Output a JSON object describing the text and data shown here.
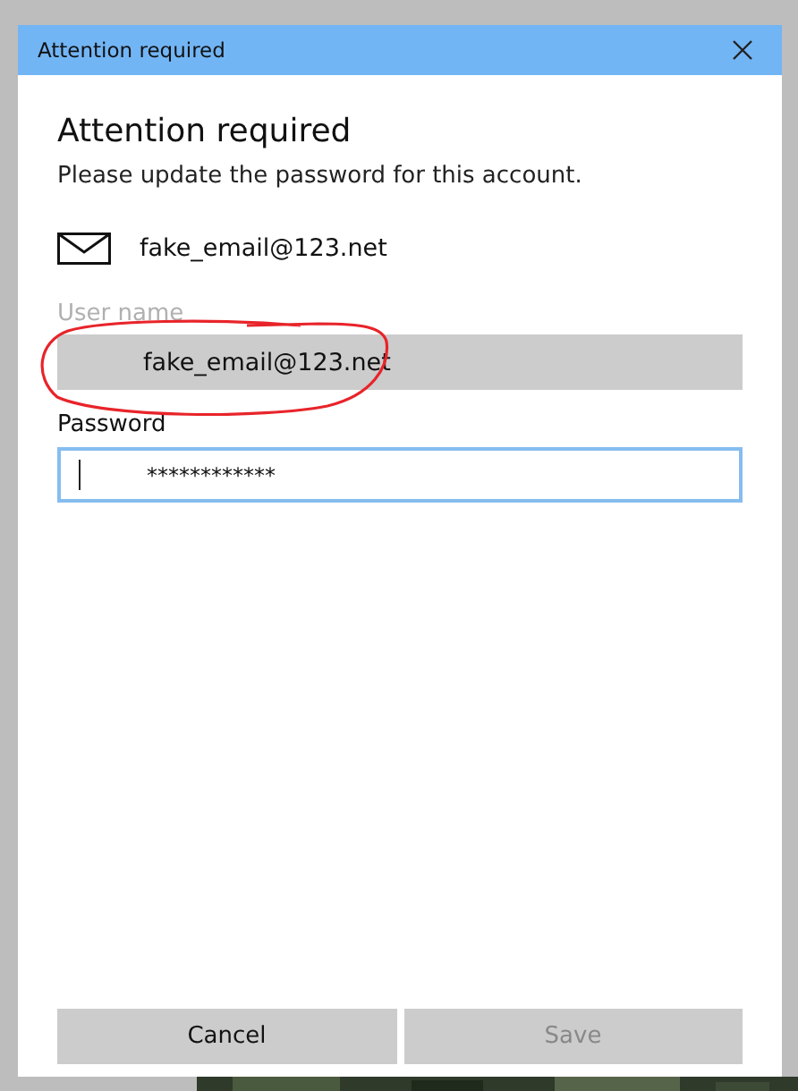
{
  "window": {
    "title": "Attention required"
  },
  "heading": "Attention required",
  "message": "Please update the password for this account.",
  "account": {
    "email": "fake_email@123.net"
  },
  "fields": [
    {
      "kind": "readonly",
      "label": "User name",
      "value": "fake_email@123.net",
      "focused": false
    },
    {
      "kind": "password",
      "label": "Password",
      "value": "************",
      "focused": true
    }
  ],
  "buttons": [
    {
      "label": "Cancel",
      "disabled": false
    },
    {
      "label": "Save",
      "disabled": true
    }
  ]
}
